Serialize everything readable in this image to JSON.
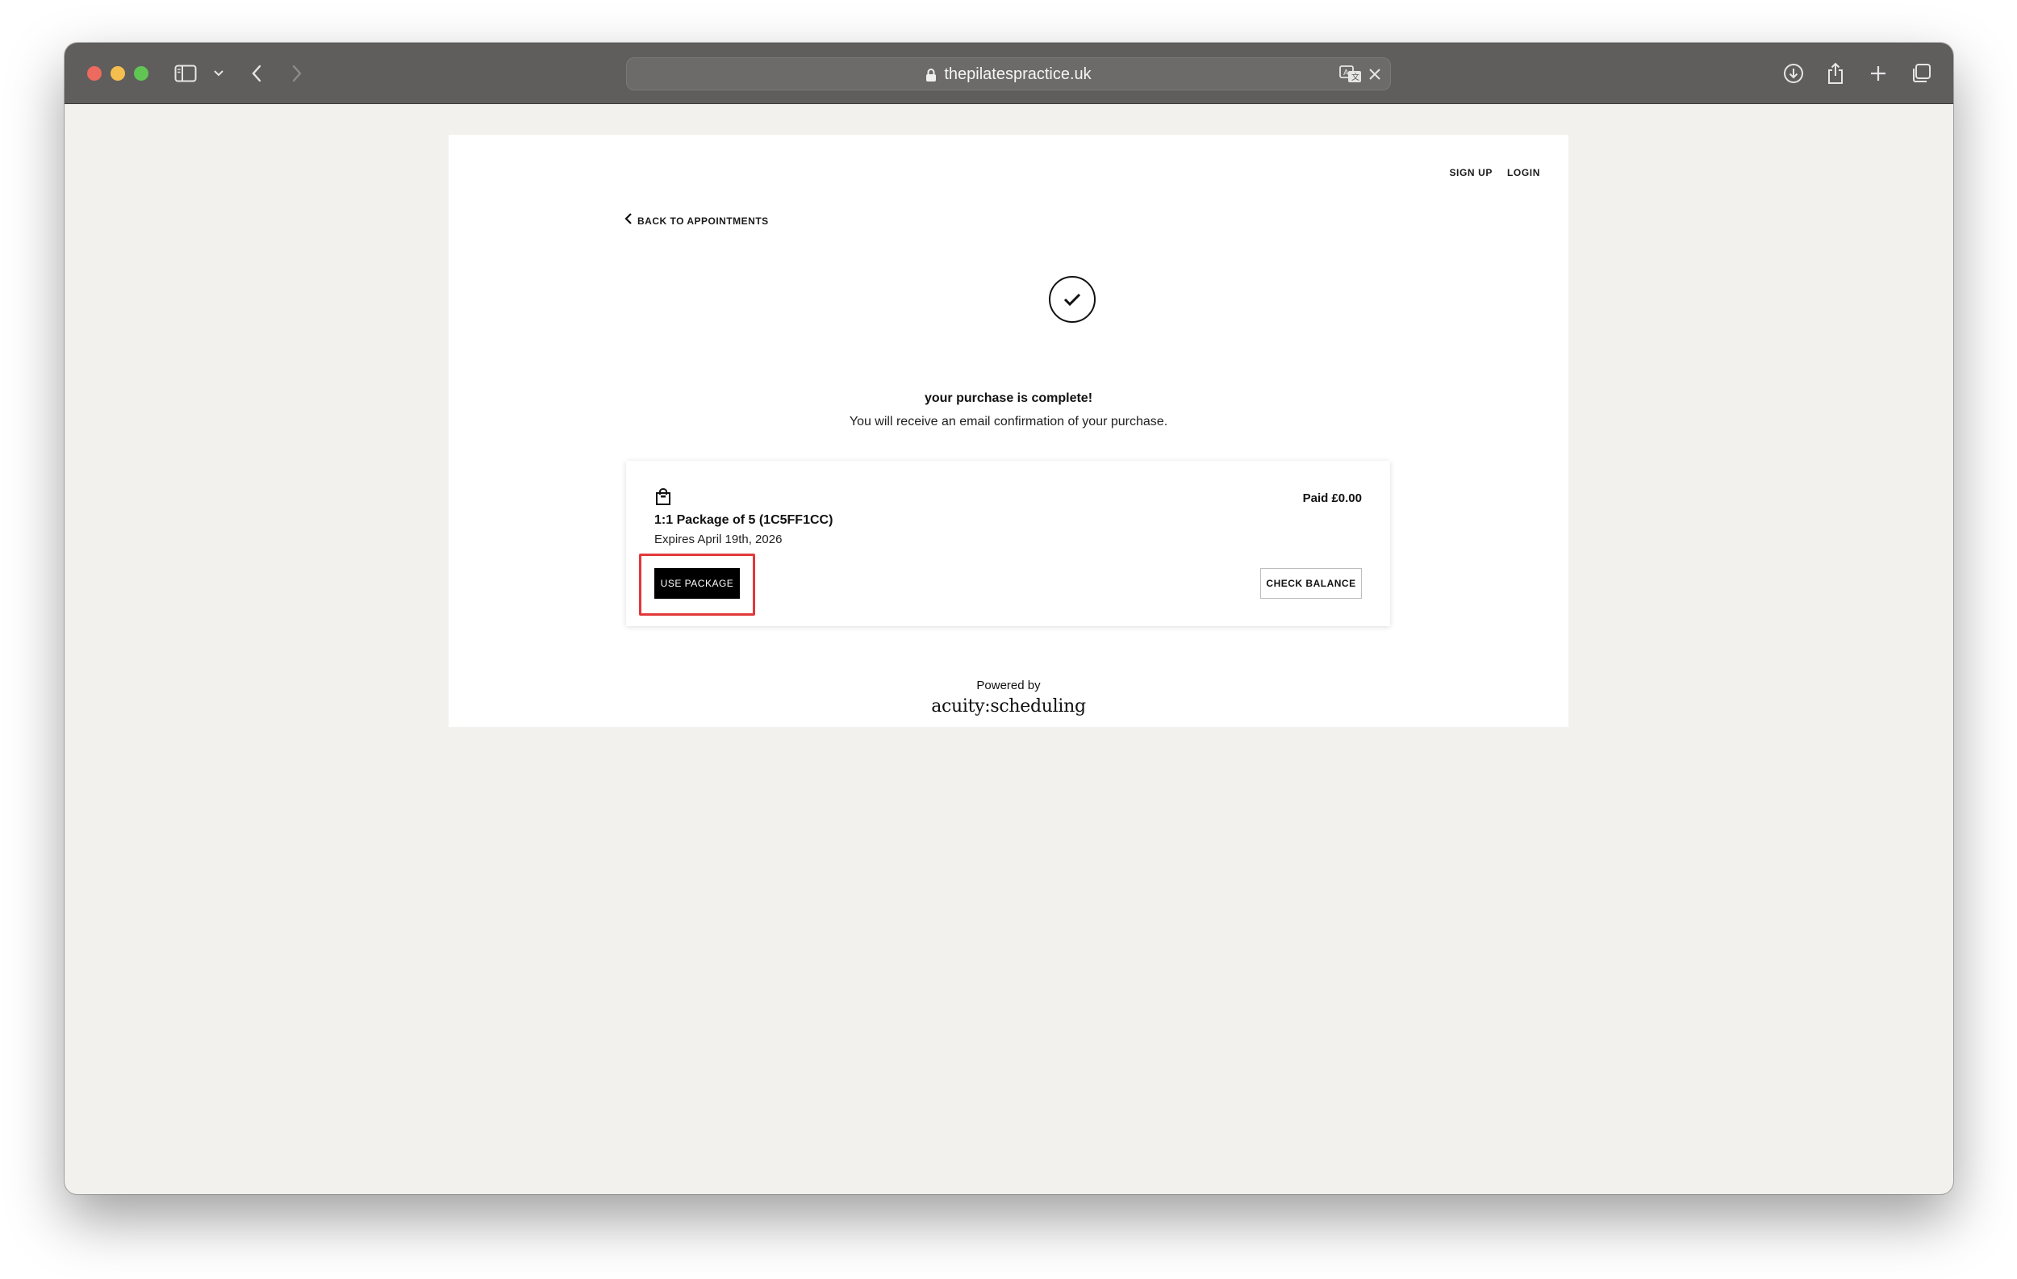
{
  "browser": {
    "url": "thepilatespractice.uk",
    "icons": {
      "lock": "lock-icon",
      "translate": "translate-icon",
      "clear": "close-icon",
      "sidebar": "sidebar-icon",
      "back": "chevron-left-icon",
      "forward": "chevron-right-icon",
      "download": "download-icon",
      "share": "share-icon",
      "new_tab": "plus-icon",
      "tabs": "tabs-overview-icon"
    }
  },
  "header": {
    "sign_up": "SIGN UP",
    "login": "LOGIN"
  },
  "back_link": {
    "label": "BACK TO APPOINTMENTS",
    "icon": "chevron-left-icon"
  },
  "confirmation": {
    "icon": "checkmark-icon",
    "headline": "your purchase is complete!",
    "subline": "You will receive an email confirmation of your purchase."
  },
  "package": {
    "icon": "shopping-bag-icon",
    "title": "1:1 Package of 5 (1C5FF1CC)",
    "expiry": "Expires April 19th, 2026",
    "paid": "Paid £0.00",
    "use_label": "USE PACKAGE",
    "balance_label": "CHECK BALANCE"
  },
  "footer": {
    "powered_by": "Powered by",
    "brand": "acuity:scheduling"
  },
  "colors": {
    "toolbar": "#5f5e5c",
    "page_background": "#f2f1ed",
    "highlight": "#e2383a",
    "primary_button": "#000000"
  }
}
